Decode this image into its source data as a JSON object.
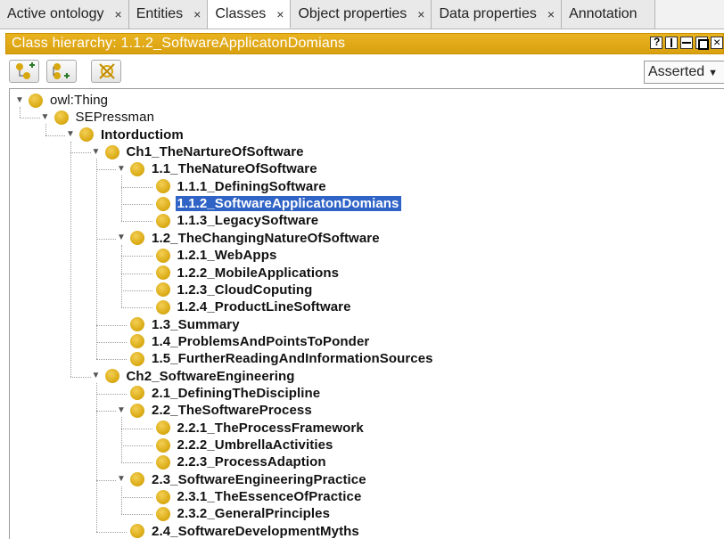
{
  "tabs": [
    {
      "label": "Active ontology",
      "close": "×",
      "active": false
    },
    {
      "label": "Entities",
      "close": "×",
      "active": false
    },
    {
      "label": "Classes",
      "close": "×",
      "active": true
    },
    {
      "label": "Object properties",
      "close": "×",
      "active": false
    },
    {
      "label": "Data properties",
      "close": "×",
      "active": false
    },
    {
      "label": "Annotation",
      "close": "",
      "active": false
    }
  ],
  "view": {
    "title": "Class hierarchy: 1.1.2_SoftwareApplicatonDomians",
    "accent": "#e0a917"
  },
  "toolbar": {
    "add_subclass_icon": "add-subclass-icon",
    "add_sibling_icon": "add-sibling-icon",
    "delete_icon": "delete-class-icon",
    "mode": "Asserted"
  },
  "tree": [
    {
      "label": "owl:Thing",
      "depth": 0,
      "expanded": true,
      "bold": false,
      "selected": false
    },
    {
      "label": "SEPressman",
      "depth": 1,
      "expanded": true,
      "bold": false,
      "selected": false
    },
    {
      "label": "Intorductiom",
      "depth": 2,
      "expanded": true,
      "bold": true,
      "selected": false
    },
    {
      "label": "Ch1_TheNartureOfSoftware",
      "depth": 3,
      "expanded": true,
      "bold": true,
      "selected": false
    },
    {
      "label": "1.1_TheNatureOfSoftware",
      "depth": 4,
      "expanded": true,
      "bold": true,
      "selected": false
    },
    {
      "label": "1.1.1_DefiningSoftware",
      "depth": 5,
      "expanded": null,
      "bold": true,
      "selected": false
    },
    {
      "label": "1.1.2_SoftwareApplicatonDomians",
      "depth": 5,
      "expanded": null,
      "bold": true,
      "selected": true
    },
    {
      "label": "1.1.3_LegacySoftware",
      "depth": 5,
      "expanded": null,
      "bold": true,
      "selected": false
    },
    {
      "label": "1.2_TheChangingNatureOfSoftware",
      "depth": 4,
      "expanded": true,
      "bold": true,
      "selected": false
    },
    {
      "label": "1.2.1_WebApps",
      "depth": 5,
      "expanded": null,
      "bold": true,
      "selected": false
    },
    {
      "label": "1.2.2_MobileApplications",
      "depth": 5,
      "expanded": null,
      "bold": true,
      "selected": false
    },
    {
      "label": "1.2.3_CloudCoputing",
      "depth": 5,
      "expanded": null,
      "bold": true,
      "selected": false
    },
    {
      "label": "1.2.4_ProductLineSoftware",
      "depth": 5,
      "expanded": null,
      "bold": true,
      "selected": false
    },
    {
      "label": "1.3_Summary",
      "depth": 4,
      "expanded": null,
      "bold": true,
      "selected": false
    },
    {
      "label": "1.4_ProblemsAndPointsToPonder",
      "depth": 4,
      "expanded": null,
      "bold": true,
      "selected": false
    },
    {
      "label": "1.5_FurtherReadingAndInformationSources",
      "depth": 4,
      "expanded": null,
      "bold": true,
      "selected": false
    },
    {
      "label": "Ch2_SoftwareEngineering",
      "depth": 3,
      "expanded": true,
      "bold": true,
      "selected": false
    },
    {
      "label": "2.1_DefiningTheDiscipline",
      "depth": 4,
      "expanded": null,
      "bold": true,
      "selected": false
    },
    {
      "label": "2.2_TheSoftwareProcess",
      "depth": 4,
      "expanded": true,
      "bold": true,
      "selected": false
    },
    {
      "label": "2.2.1_TheProcessFramework",
      "depth": 5,
      "expanded": null,
      "bold": true,
      "selected": false
    },
    {
      "label": "2.2.2_UmbrellaActivities",
      "depth": 5,
      "expanded": null,
      "bold": true,
      "selected": false
    },
    {
      "label": "2.2.3_ProcessAdaption",
      "depth": 5,
      "expanded": null,
      "bold": true,
      "selected": false
    },
    {
      "label": "2.3_SoftwareEngineeringPractice",
      "depth": 4,
      "expanded": true,
      "bold": true,
      "selected": false
    },
    {
      "label": "2.3.1_TheEssenceOfPractice",
      "depth": 5,
      "expanded": null,
      "bold": true,
      "selected": false
    },
    {
      "label": "2.3.2_GeneralPrinciples",
      "depth": 5,
      "expanded": null,
      "bold": true,
      "selected": false
    },
    {
      "label": "2.4_SoftwareDevelopmentMyths",
      "depth": 4,
      "expanded": null,
      "bold": true,
      "selected": false
    }
  ]
}
